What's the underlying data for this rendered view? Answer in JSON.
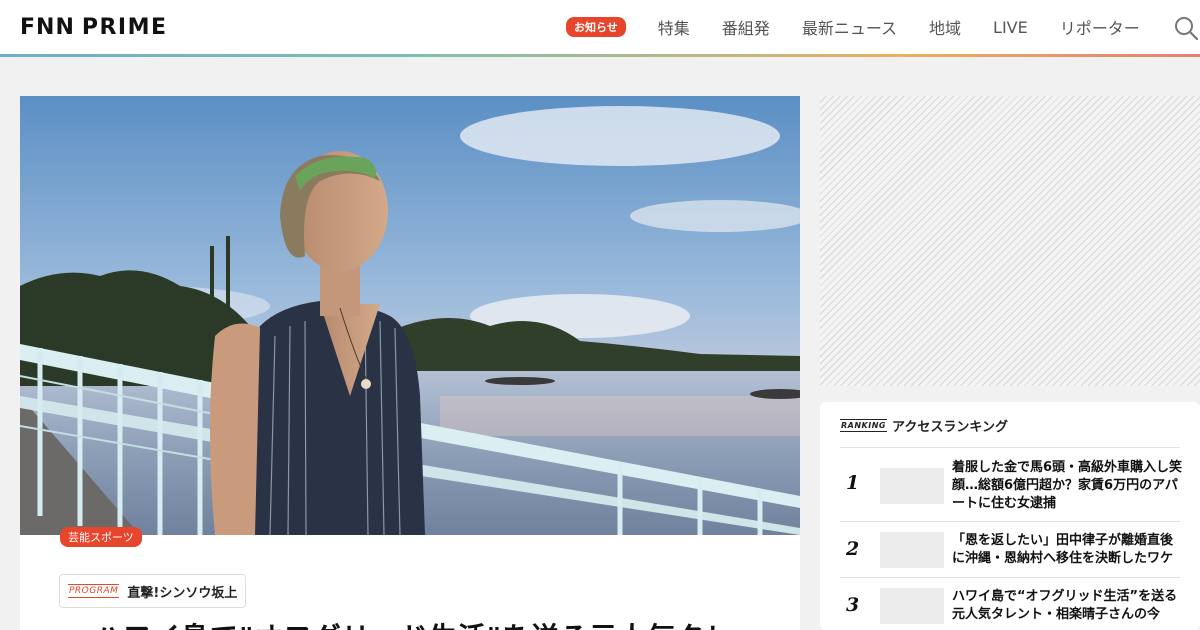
{
  "header": {
    "logo_left": "FNN",
    "logo_right": "PRIME",
    "notice_badge": "お知らせ",
    "nav": [
      "特集",
      "番組発",
      "最新ニュース",
      "地域",
      "LIVE",
      "リポーター"
    ]
  },
  "article": {
    "category": "芸能スポーツ",
    "program_label": "PROGRAM",
    "program_name": "直撃!シンソウ坂上",
    "headline": "ハワイ島で\"オフグリッド生活\"を送る元人気タレ"
  },
  "ranking": {
    "label": "RANKING",
    "title": "アクセスランキング",
    "items": [
      {
        "rank": "1",
        "text": "着服した金で馬6頭・高級外車購入し笑顔…総額6億円超か？家賃6万円のアパートに住む女逮捕"
      },
      {
        "rank": "2",
        "text": "「恩を返したい」田中律子が離婚直後に沖縄・恩納村へ移住を決断したワケ"
      },
      {
        "rank": "3",
        "text": "ハワイ島で“オフグリッド生活”を送る元人気タレント・相楽晴子さんの今"
      }
    ]
  },
  "colors": {
    "accent": "#e8452d"
  }
}
